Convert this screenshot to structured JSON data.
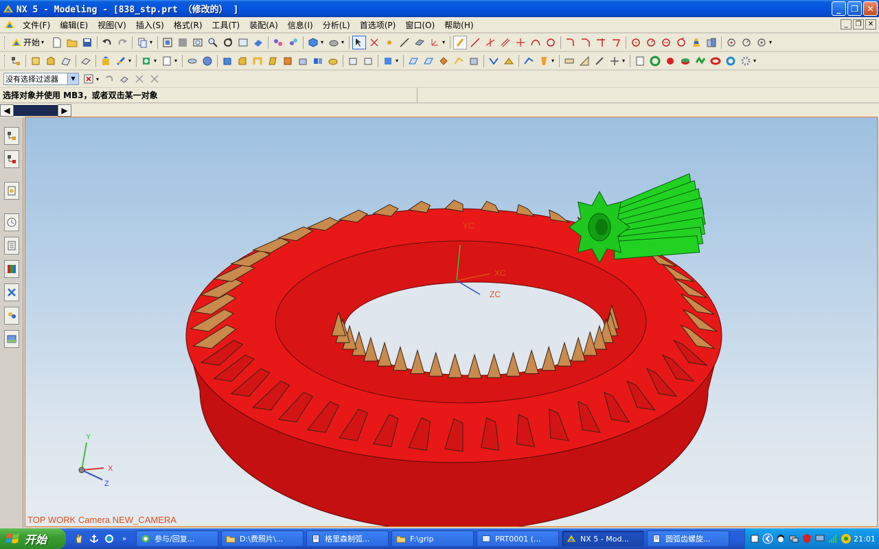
{
  "window": {
    "title": "NX 5 - Modeling - [838_stp.prt （修改的） ]"
  },
  "menu": {
    "items": [
      "文件(F)",
      "编辑(E)",
      "视图(V)",
      "插入(S)",
      "格式(R)",
      "工具(T)",
      "装配(A)",
      "信息(I)",
      "分析(L)",
      "首选项(P)",
      "窗口(O)",
      "帮助(H)"
    ]
  },
  "toolbar": {
    "start_label": "开始"
  },
  "selection": {
    "filter_value": "没有选择过滤器"
  },
  "cue": {
    "text": "选择对象并使用 MB3，或者双击某一对象"
  },
  "viewport": {
    "wcs_labels": {
      "y": "YC",
      "x": "XC",
      "z": "ZC"
    },
    "triad_labels": {
      "y": "Y",
      "x": "X",
      "z": "Z"
    },
    "view_label": "TOP WORK Camera NEW_CAMERA",
    "colors": {
      "ring_gear": "#e81818",
      "ring_gear_tooth": "#c98a4e",
      "pinion": "#22d222",
      "wcs": "#e0501a"
    }
  },
  "taskbar": {
    "start_label": "开始",
    "tasks": [
      {
        "label": "参与/回复...",
        "icon": "ie-icon"
      },
      {
        "label": "D:\\费照片\\...",
        "icon": "folder-icon"
      },
      {
        "label": "格里森制弧...",
        "icon": "document-icon"
      },
      {
        "label": "F:\\grip",
        "icon": "folder-icon"
      },
      {
        "label": "PRT0001 (...",
        "icon": "nx-window-icon"
      },
      {
        "label": "NX 5 - Mod...",
        "icon": "nx-icon"
      },
      {
        "label": "圆弧齿螺旋...",
        "icon": "document-icon"
      }
    ],
    "clock": "21:01"
  }
}
